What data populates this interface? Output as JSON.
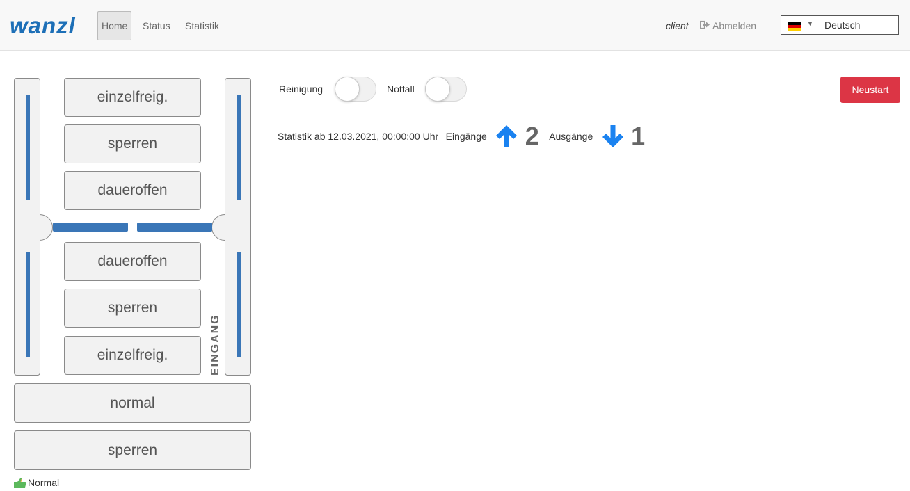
{
  "navbar": {
    "logo": "wanzl",
    "links": {
      "home": "Home",
      "status": "Status",
      "statistik": "Statistik"
    },
    "client": "client",
    "logout": "Abmelden",
    "language": "Deutsch",
    "flag_colors": [
      "#000000",
      "#dd0000",
      "#ffce00"
    ]
  },
  "door_panel": {
    "top_buttons": [
      "einzelfreig.",
      "sperren",
      "daueroffen"
    ],
    "bottom_buttons": [
      "daueroffen",
      "sperren",
      "einzelfreig."
    ],
    "side_label": "EINGANG",
    "mode_buttons": [
      "normal",
      "sperren"
    ],
    "status": "Normal",
    "accent_color": "#3a76b7"
  },
  "controls": {
    "cleaning_label": "Reinigung",
    "cleaning_on": false,
    "emergency_label": "Notfall",
    "emergency_on": false,
    "restart_label": "Neustart",
    "restart_color": "#dc3545"
  },
  "statistics": {
    "since_text": "Statistik ab 12.03.2021, 00:00:00 Uhr",
    "entries_label": "Eingänge",
    "entries_count": "2",
    "exits_label": "Ausgänge",
    "exits_count": "1",
    "arrow_color": "#1a82f0"
  }
}
